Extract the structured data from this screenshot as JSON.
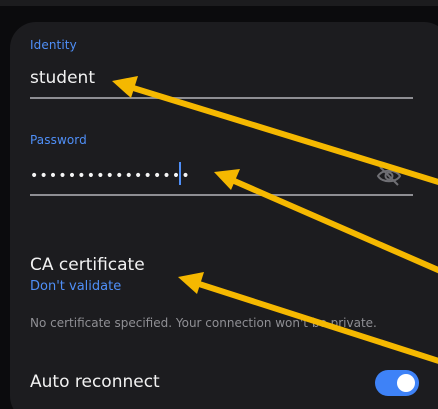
{
  "identity": {
    "label": "Identity",
    "value": "student"
  },
  "password": {
    "label": "Password",
    "masked_value": "•••••••••••••••••",
    "visibility_icon": "eye-off-icon"
  },
  "ca_certificate": {
    "title": "CA certificate",
    "selected": "Don't validate",
    "help_text": "No certificate specified. Your connection won't be private."
  },
  "auto_reconnect": {
    "label": "Auto reconnect",
    "enabled": true
  },
  "annotations": {
    "arrow_color": "#f5b800",
    "arrow_count": 3
  },
  "colors": {
    "accent": "#4f8ff7",
    "card_background": "#1c1c1f",
    "toggle_on": "#3e82f7"
  }
}
